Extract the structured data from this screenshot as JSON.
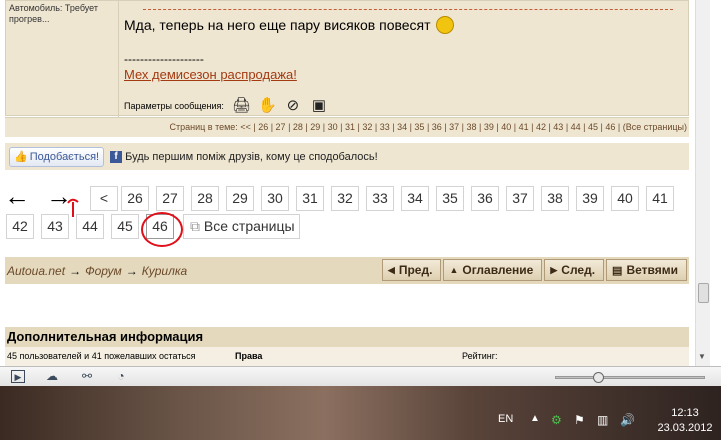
{
  "post": {
    "profile_text": "Автомобиль: Требует прогрев...",
    "message": "Мда, теперь на него еще пару висяков повесят",
    "separator": "--------------------",
    "signature_link": "Мех демисезон распродажа!",
    "params_label": "Параметры сообщения:",
    "param_icons": [
      "print-icon",
      "hand-icon",
      "block-icon",
      "network-icon"
    ]
  },
  "topic_pager": {
    "label": "Страниц в теме:",
    "first": "<<",
    "pages": [
      "26",
      "27",
      "28",
      "29",
      "30",
      "31",
      "32",
      "33",
      "34",
      "35",
      "36",
      "37",
      "38",
      "39",
      "40",
      "41",
      "42",
      "43",
      "44",
      "45",
      "46"
    ],
    "all": "(Все страницы)"
  },
  "like": {
    "button": "Подобається!",
    "text": "Будь першим поміж друзів, кому це сподобалось!"
  },
  "pagination": {
    "back_arrow": "←",
    "forward_arrow": "→",
    "prev": "<",
    "row1": [
      "26",
      "27",
      "28",
      "29",
      "30",
      "31",
      "32",
      "33",
      "34",
      "35",
      "36",
      "37",
      "38",
      "39",
      "40",
      "41"
    ],
    "row2": [
      "42",
      "43",
      "44",
      "45",
      "46"
    ],
    "all_pages": "Все страницы",
    "current": "46"
  },
  "breadcrumb": {
    "items": [
      "Autoua.net",
      "Форум",
      "Курилка"
    ],
    "separator": "→"
  },
  "nav_buttons": {
    "prev": "Пред.",
    "toc": "Оглавление",
    "next": "След.",
    "threads": "Ветвями"
  },
  "info": {
    "title": "Дополнительная информация",
    "users": "45 пользователей и 41 пожелавших остаться",
    "rights": "Права",
    "rating": "Рейтинг:"
  },
  "taskbar": {
    "lang": "EN",
    "time": "12:13",
    "date": "23.03.2012"
  },
  "colors": {
    "panel": "#efe6d2",
    "nav": "#e4d8bd",
    "link": "#a33a11",
    "annotation": "#e0101a"
  }
}
